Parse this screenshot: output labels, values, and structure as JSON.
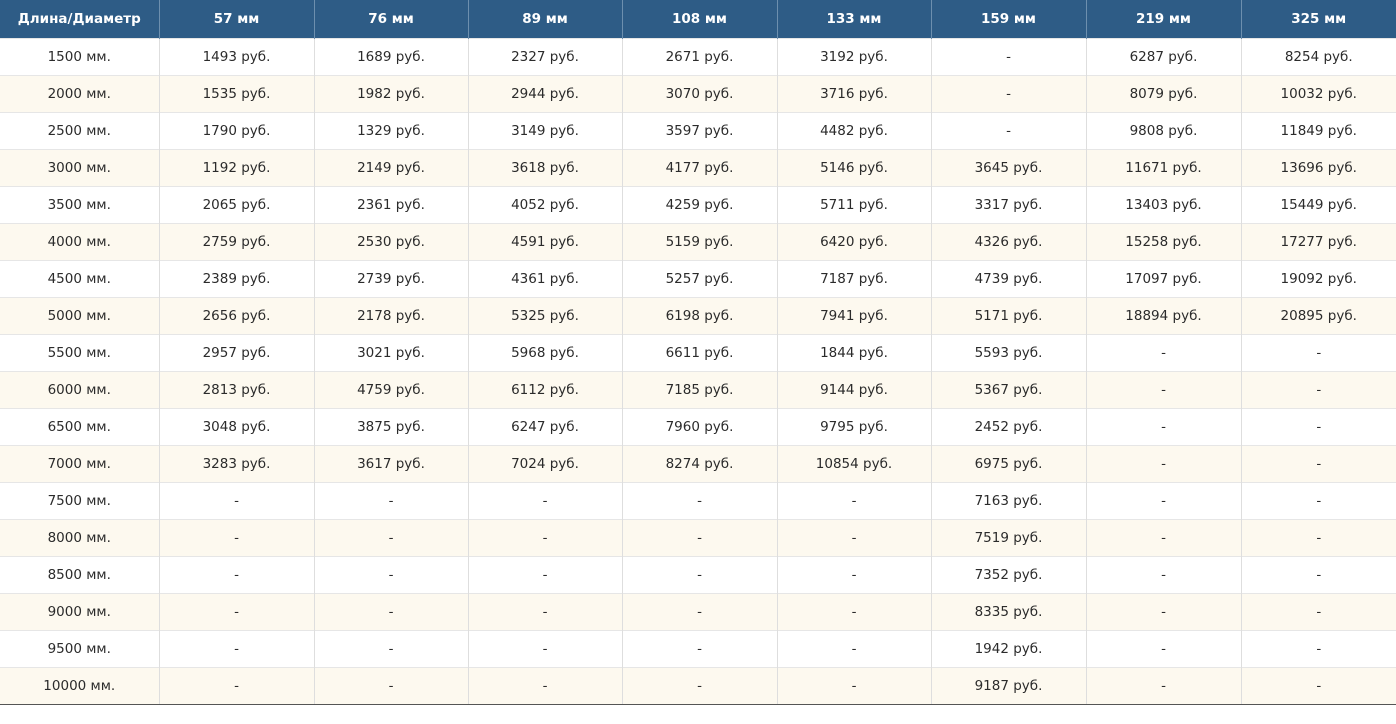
{
  "header": [
    "Длина/Диаметр",
    "57 мм",
    "76 мм",
    "89 мм",
    "108 мм",
    "133 мм",
    "159 мм",
    "219 мм",
    "325 мм"
  ],
  "rows": [
    [
      "1500 мм.",
      "1493 руб.",
      "1689 руб.",
      "2327 руб.",
      "2671 руб.",
      "3192 руб.",
      "-",
      "6287 руб.",
      "8254 руб."
    ],
    [
      "2000 мм.",
      "1535 руб.",
      "1982 руб.",
      "2944 руб.",
      "3070 руб.",
      "3716 руб.",
      "-",
      "8079 руб.",
      "10032 руб."
    ],
    [
      "2500 мм.",
      "1790 руб.",
      "1329 руб.",
      "3149 руб.",
      "3597 руб.",
      "4482 руб.",
      "-",
      "9808 руб.",
      "11849 руб."
    ],
    [
      "3000 мм.",
      "1192 руб.",
      "2149 руб.",
      "3618 руб.",
      "4177 руб.",
      "5146 руб.",
      "3645 руб.",
      "11671 руб.",
      "13696 руб."
    ],
    [
      "3500 мм.",
      "2065 руб.",
      "2361 руб.",
      "4052 руб.",
      "4259 руб.",
      "5711 руб.",
      "3317 руб.",
      "13403 руб.",
      "15449 руб."
    ],
    [
      "4000 мм.",
      "2759 руб.",
      "2530 руб.",
      "4591 руб.",
      "5159 руб.",
      "6420 руб.",
      "4326 руб.",
      "15258 руб.",
      "17277 руб."
    ],
    [
      "4500 мм.",
      "2389 руб.",
      "2739 руб.",
      "4361 руб.",
      "5257 руб.",
      "7187 руб.",
      "4739 руб.",
      "17097 руб.",
      "19092 руб."
    ],
    [
      "5000 мм.",
      "2656 руб.",
      "2178 руб.",
      "5325 руб.",
      "6198 руб.",
      "7941 руб.",
      "5171 руб.",
      "18894 руб.",
      "20895 руб."
    ],
    [
      "5500 мм.",
      "2957 руб.",
      "3021 руб.",
      "5968 руб.",
      "6611 руб.",
      "1844 руб.",
      "5593 руб.",
      "-",
      "-"
    ],
    [
      "6000 мм.",
      "2813 руб.",
      "4759 руб.",
      "6112 руб.",
      "7185 руб.",
      "9144 руб.",
      "5367 руб.",
      "-",
      "-"
    ],
    [
      "6500 мм.",
      "3048 руб.",
      "3875 руб.",
      "6247 руб.",
      "7960 руб.",
      "9795 руб.",
      "2452 руб.",
      "-",
      "-"
    ],
    [
      "7000 мм.",
      "3283 руб.",
      "3617 руб.",
      "7024 руб.",
      "8274 руб.",
      "10854 руб.",
      "6975 руб.",
      "-",
      "-"
    ],
    [
      "7500 мм.",
      "-",
      "-",
      "-",
      "-",
      "-",
      "7163 руб.",
      "-",
      "-"
    ],
    [
      "8000 мм.",
      "-",
      "-",
      "-",
      "-",
      "-",
      "7519 руб.",
      "-",
      "-"
    ],
    [
      "8500 мм.",
      "-",
      "-",
      "-",
      "-",
      "-",
      "7352 руб.",
      "-",
      "-"
    ],
    [
      "9000 мм.",
      "-",
      "-",
      "-",
      "-",
      "-",
      "8335 руб.",
      "-",
      "-"
    ],
    [
      "9500 мм.",
      "-",
      "-",
      "-",
      "-",
      "-",
      "1942 руб.",
      "-",
      "-"
    ],
    [
      "10000 мм.",
      "-",
      "-",
      "-",
      "-",
      "-",
      "9187 руб.",
      "-",
      "-"
    ]
  ],
  "colors": {
    "header_bg": "#2e5c86",
    "header_text": "#ffffff",
    "row_alt_bg": "#fdf9ef"
  }
}
